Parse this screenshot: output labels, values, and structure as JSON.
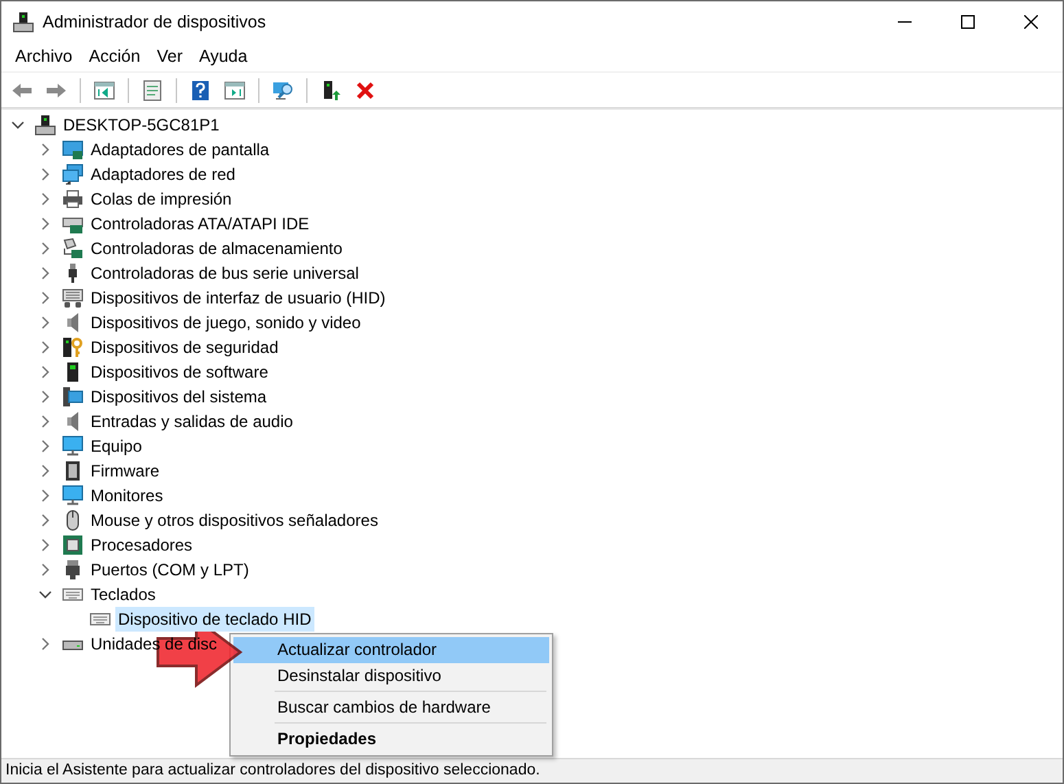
{
  "window": {
    "title": "Administrador de dispositivos"
  },
  "menu": [
    "Archivo",
    "Acción",
    "Ver",
    "Ayuda"
  ],
  "toolbar": [
    {
      "kind": "back"
    },
    {
      "kind": "forward"
    },
    {
      "kind": "separator"
    },
    {
      "kind": "tree"
    },
    {
      "kind": "separator"
    },
    {
      "kind": "properties"
    },
    {
      "kind": "separator"
    },
    {
      "kind": "help"
    },
    {
      "kind": "pane"
    },
    {
      "kind": "separator"
    },
    {
      "kind": "scan"
    },
    {
      "kind": "separator"
    },
    {
      "kind": "update"
    },
    {
      "kind": "remove"
    }
  ],
  "tree": {
    "label": "DESKTOP-5GC81P1",
    "kind": "computer",
    "expanded": true,
    "selected": false,
    "children": [
      {
        "label": "Adaptadores de pantalla",
        "kind": "display",
        "expanded": false,
        "selected": false
      },
      {
        "label": "Adaptadores de red",
        "kind": "network",
        "expanded": false,
        "selected": false
      },
      {
        "label": "Colas de impresión",
        "kind": "printer",
        "expanded": false,
        "selected": false
      },
      {
        "label": "Controladoras ATA/ATAPI IDE",
        "kind": "card",
        "expanded": false,
        "selected": false
      },
      {
        "label": "Controladoras de almacenamiento",
        "kind": "storage",
        "expanded": false,
        "selected": false
      },
      {
        "label": "Controladoras de bus serie universal",
        "kind": "usb",
        "expanded": false,
        "selected": false
      },
      {
        "label": "Dispositivos de interfaz de usuario (HID)",
        "kind": "hid",
        "expanded": false,
        "selected": false
      },
      {
        "label": "Dispositivos de juego, sonido y video",
        "kind": "speaker",
        "expanded": false,
        "selected": false
      },
      {
        "label": "Dispositivos de seguridad",
        "kind": "security",
        "expanded": false,
        "selected": false
      },
      {
        "label": "Dispositivos de software",
        "kind": "tower",
        "expanded": false,
        "selected": false
      },
      {
        "label": "Dispositivos del sistema",
        "kind": "system",
        "expanded": false,
        "selected": false
      },
      {
        "label": "Entradas y salidas de audio",
        "kind": "speaker",
        "expanded": false,
        "selected": false
      },
      {
        "label": "Equipo",
        "kind": "monitor",
        "expanded": false,
        "selected": false
      },
      {
        "label": "Firmware",
        "kind": "chip",
        "expanded": false,
        "selected": false
      },
      {
        "label": "Monitores",
        "kind": "monitor",
        "expanded": false,
        "selected": false
      },
      {
        "label": "Mouse y otros dispositivos señaladores",
        "kind": "mouse",
        "expanded": false,
        "selected": false
      },
      {
        "label": "Procesadores",
        "kind": "cpu",
        "expanded": false,
        "selected": false
      },
      {
        "label": "Puertos (COM y LPT)",
        "kind": "port",
        "expanded": false,
        "selected": false
      },
      {
        "label": "Teclados",
        "kind": "keyboard",
        "expanded": true,
        "selected": false,
        "children": [
          {
            "label": "Dispositivo de teclado HID",
            "kind": "keyboard",
            "selected": true
          }
        ]
      },
      {
        "label": "Unidades de disc",
        "kind": "disk",
        "expanded": false,
        "selected": false
      }
    ]
  },
  "context_menu": [
    {
      "kind": "item",
      "label": "Actualizar controlador",
      "selected": true,
      "default": false
    },
    {
      "kind": "item",
      "label": "Desinstalar dispositivo",
      "selected": false,
      "default": false
    },
    {
      "kind": "separator"
    },
    {
      "kind": "item",
      "label": "Buscar cambios de hardware",
      "selected": false,
      "default": false
    },
    {
      "kind": "separator"
    },
    {
      "kind": "item",
      "label": "Propiedades",
      "selected": false,
      "default": true
    }
  ],
  "status_bar": "Inicia el Asistente para actualizar controladores del dispositivo seleccionado."
}
